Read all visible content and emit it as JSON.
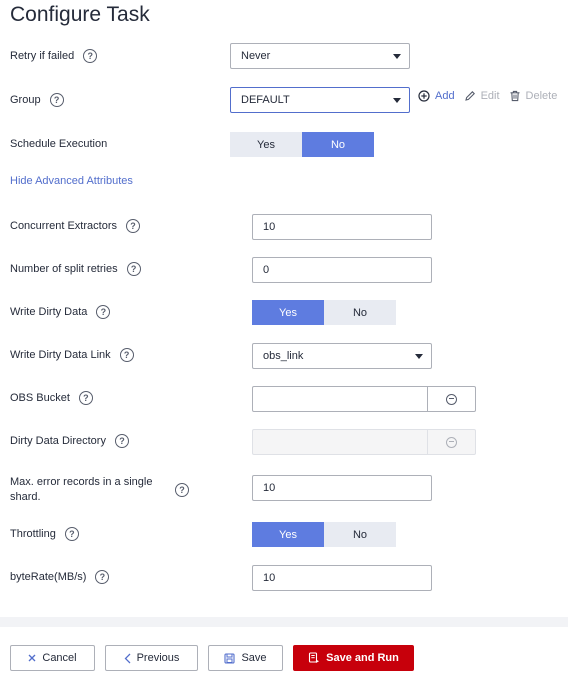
{
  "page": {
    "title": "Configure Task"
  },
  "retry": {
    "label": "Retry if failed",
    "value": "Never"
  },
  "group": {
    "label": "Group",
    "value": "DEFAULT",
    "add_label": "Add",
    "edit_label": "Edit",
    "delete_label": "Delete"
  },
  "schedule": {
    "label": "Schedule Execution",
    "yes": "Yes",
    "no": "No",
    "selected": "No"
  },
  "advanced": {
    "toggle_label": "Hide Advanced Attributes"
  },
  "extractors": {
    "label": "Concurrent Extractors",
    "value": "10"
  },
  "split_retries": {
    "label": "Number of split retries",
    "value": "0"
  },
  "dirty_data": {
    "label": "Write Dirty Data",
    "yes": "Yes",
    "no": "No",
    "selected": "Yes"
  },
  "dirty_link": {
    "label": "Write Dirty Data Link",
    "value": "obs_link"
  },
  "obs_bucket": {
    "label": "OBS Bucket",
    "value": ""
  },
  "dirty_dir": {
    "label": "Dirty Data Directory",
    "value": ""
  },
  "max_errors": {
    "label_line1": "Max. error records in a single",
    "label_line2": "shard.",
    "value": "10"
  },
  "throttling": {
    "label": "Throttling",
    "yes": "Yes",
    "no": "No",
    "selected": "Yes"
  },
  "byte_rate": {
    "label": "byteRate(MB/s)",
    "value": "10"
  },
  "footer": {
    "cancel_label": "Cancel",
    "previous_label": "Previous",
    "save_label": "Save",
    "save_run_label": "Save and Run"
  },
  "colors": {
    "primary": "#5e7ce0",
    "link": "#526ecc",
    "danger": "#c7000b",
    "segment_off": "#e8ebf2"
  }
}
